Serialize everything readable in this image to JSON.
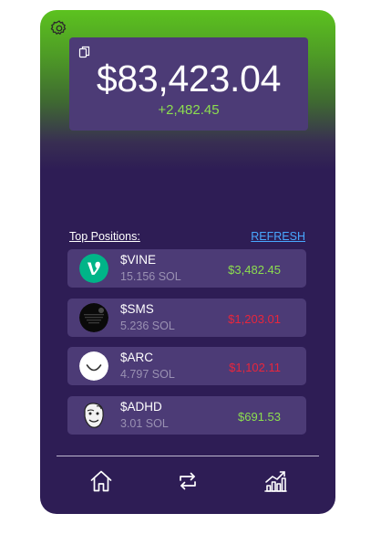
{
  "balance": {
    "total": "$83,423.04",
    "change": "+2,482.45"
  },
  "section": {
    "title": "Top Positions:",
    "refresh_label": "REFRESH"
  },
  "positions": [
    {
      "symbol": "$VINE",
      "amount": "15.156 SOL",
      "value": "$3,482.45",
      "trend": "up",
      "icon": "vine-logo-icon"
    },
    {
      "symbol": "$SMS",
      "amount": "5.236 SOL",
      "value": "$1,203.01",
      "trend": "down",
      "icon": "sms-token-icon"
    },
    {
      "symbol": "$ARC",
      "amount": "4.797 SOL",
      "value": "$1,102.11",
      "trend": "down",
      "icon": "arc-smiley-icon"
    },
    {
      "symbol": "$ADHD",
      "amount": "3.01 SOL",
      "value": "$691.53",
      "trend": "up",
      "icon": "adhd-meme-icon"
    }
  ],
  "colors": {
    "positive": "#8cde4f",
    "negative": "#e8263c",
    "accent_link": "#48a8ff",
    "panel": "#4c3b76",
    "background": "#2e1d55",
    "header_green": "#5cc21f"
  },
  "nav": {
    "items": [
      "home-icon",
      "swap-icon",
      "chart-icon"
    ]
  }
}
